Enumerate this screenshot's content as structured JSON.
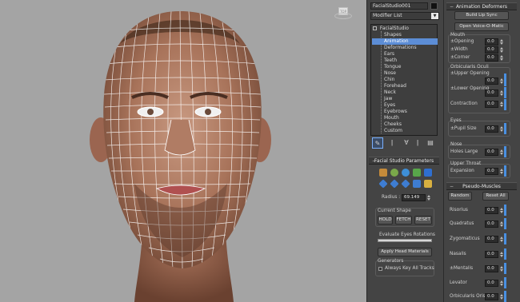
{
  "viewport": {
    "viewcube_label": "TOP"
  },
  "modify_panel": {
    "object_name": "FacialStudio001",
    "modifier_list": "Modifier List",
    "stack_root": "FacialStudio",
    "stack_items": [
      "Shapes",
      "Animation",
      "Deformations",
      "Ears",
      "Teeth",
      "Tongue",
      "Nose",
      "Chin",
      "Forehead",
      "Neck",
      "Jaw",
      "Eyes",
      "Eyebrows",
      "Mouth",
      "Cheeks",
      "Custom"
    ],
    "selected_item": "Animation"
  },
  "params": {
    "title": "Facial Studio Parameters",
    "radius_label": "Radius :",
    "radius_value": "69.149",
    "current_shape_label": "Current Shape",
    "hold": "HOLD",
    "fetch": "FETCH",
    "reset": "RESET",
    "eval_eyes": "Evaluate Eyes Rotations",
    "apply_materials": "Apply Head Materials",
    "generators": "Generators",
    "always_key": "Always Key All Tracks"
  },
  "deformers": {
    "title": "Animation Deformers",
    "build_lip_sync": "Build Lip Sync",
    "open_voice": "Open Voice-O-Matic",
    "mouth_group": "Mouth",
    "mouth_rows": [
      {
        "label": "±Opening",
        "value": "0.0"
      },
      {
        "label": "±Width",
        "value": "0.0"
      },
      {
        "label": "±Corner",
        "value": "0.0"
      }
    ],
    "oculi_group": "Orbicularis Oculi",
    "upper_opening": "±Upper Opening",
    "upper_opening_value": "0.0",
    "lower_opening": "±Lower Opening",
    "lower_opening_value": "0.0",
    "contraction": "Contraction",
    "contraction_value": "0.0",
    "eyes_group": "Eyes",
    "pupil_size": "±Pupil Size",
    "pupil_size_value": "0.0",
    "nose_group": "Nose",
    "holes_large": "Holes Large",
    "holes_large_value": "0.0",
    "throat_group": "Upper Throat",
    "expansion": "Expansion",
    "expansion_value": "0.0"
  },
  "muscles": {
    "title": "Pseudo-Muscles",
    "random": "Random",
    "reset_all": "Reset All",
    "rows": [
      {
        "label": "Risorius",
        "value": "0.0"
      },
      {
        "label": "Quadratus",
        "value": "0.0"
      },
      {
        "label": "Zygomaticus",
        "value": "0.0"
      },
      {
        "label": "Nasalis",
        "value": "0.0"
      },
      {
        "label": "±Mentalis",
        "value": "0.0"
      },
      {
        "label": "Levator",
        "value": "0.0"
      },
      {
        "label": "Orbicularis Oris",
        "value": "0.0"
      }
    ]
  }
}
